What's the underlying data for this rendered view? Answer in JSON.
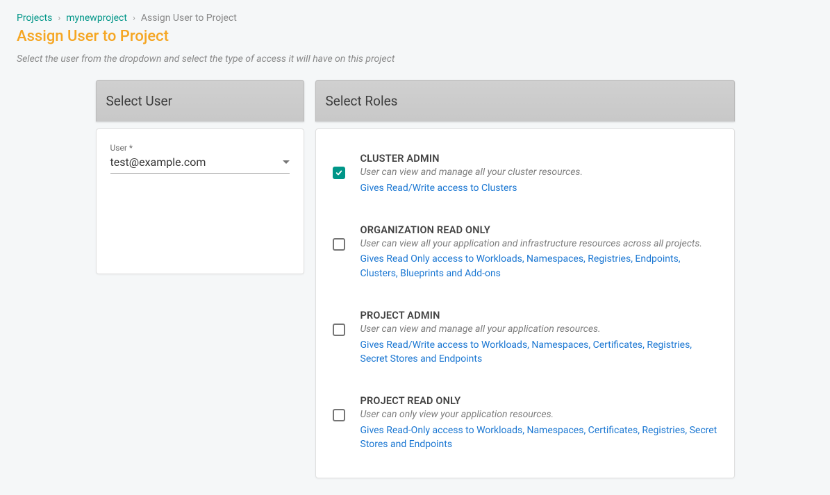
{
  "breadcrumb": {
    "root": "Projects",
    "project": "mynewproject",
    "current": "Assign User to Project",
    "sep": "›"
  },
  "header": {
    "title": "Assign User to Project",
    "subtitle": "Select the user from the dropdown and select the type of access it will have on this project"
  },
  "panels": {
    "user_header": "Select User",
    "roles_header": "Select Roles"
  },
  "user_field": {
    "label": "User *",
    "value": "test@example.com"
  },
  "roles": [
    {
      "checked": true,
      "title": "CLUSTER ADMIN",
      "desc": "User can view and manage all your cluster resources.",
      "access": "Gives Read/Write access to Clusters"
    },
    {
      "checked": false,
      "title": "ORGANIZATION READ ONLY",
      "desc": "User can view all your application and infrastructure resources across all projects.",
      "access": "Gives Read Only access to Workloads, Namespaces, Registries, Endpoints, Clusters, Blueprints and Add-ons"
    },
    {
      "checked": false,
      "title": "PROJECT ADMIN",
      "desc": "User can view and manage all your application resources.",
      "access": "Gives Read/Write access to Workloads, Namespaces, Certificates, Registries, Secret Stores and Endpoints"
    },
    {
      "checked": false,
      "title": "PROJECT READ ONLY",
      "desc": "User can only view your application resources.",
      "access": "Gives Read-Only access to Workloads, Namespaces, Certificates, Registries, Secret Stores and Endpoints"
    }
  ]
}
